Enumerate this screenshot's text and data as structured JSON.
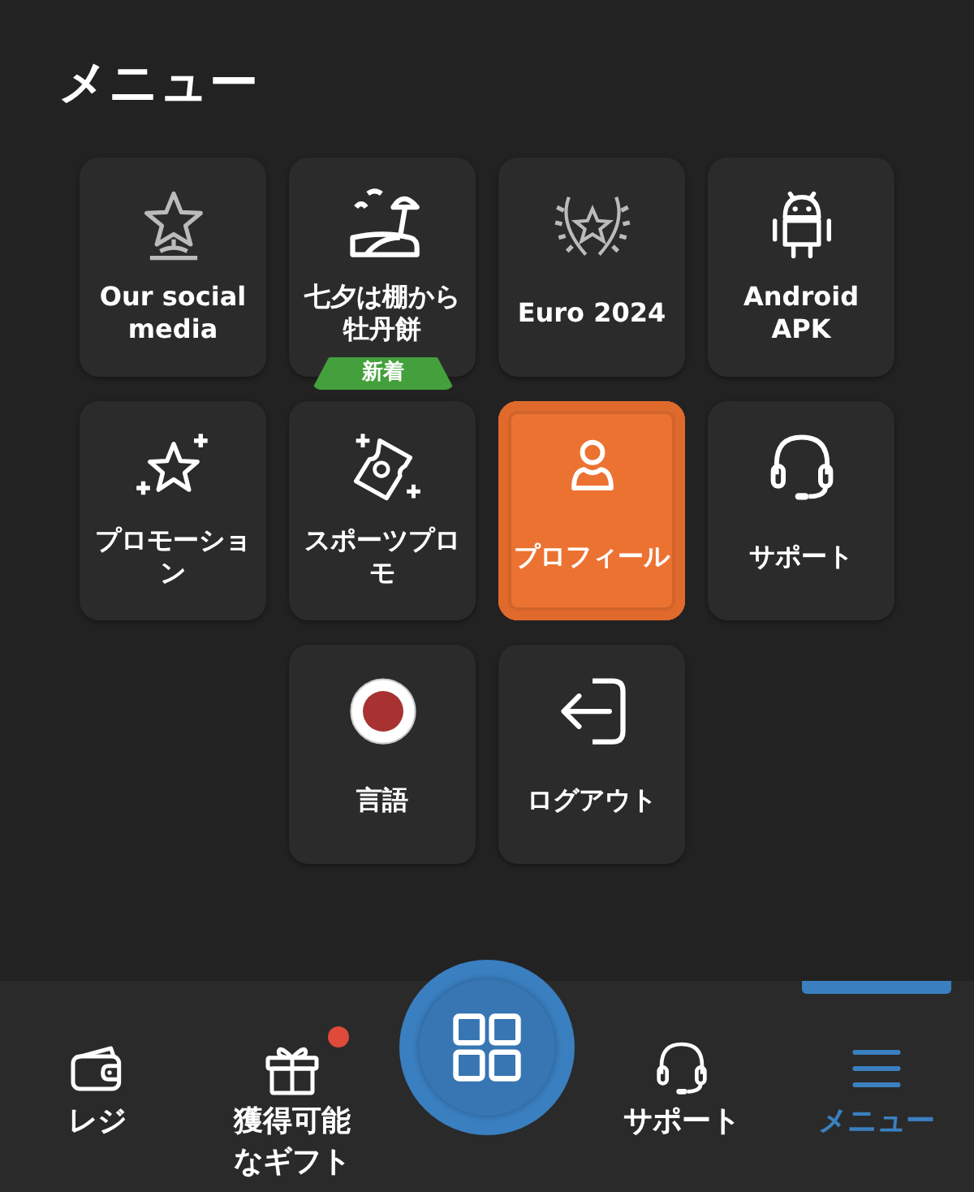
{
  "title": "メニュー",
  "grid": [
    [
      {
        "label": "Our social media",
        "selected": false
      },
      {
        "label": "七夕は棚から牡丹餅",
        "selected": false,
        "badge": "新着"
      },
      {
        "label": "Euro 2024",
        "selected": false
      },
      {
        "label": "Android APK",
        "selected": false
      }
    ],
    [
      {
        "label": "プロモーション",
        "selected": false
      },
      {
        "label": "スポーツプロモ",
        "selected": false
      },
      {
        "label": "プロフィール",
        "selected": true
      },
      {
        "label": "サポート",
        "selected": false
      }
    ],
    [
      {
        "label": "言語",
        "selected": false
      },
      {
        "label": "ログアウト",
        "selected": false
      }
    ]
  ],
  "nav": [
    {
      "kind": "tab",
      "label": "レジ",
      "selected": false,
      "dot": false
    },
    {
      "kind": "tab",
      "label": "獲得可能なギフト",
      "selected": false,
      "dot": true
    },
    {
      "kind": "fab"
    },
    {
      "kind": "tab",
      "label": "サポート",
      "selected": false,
      "dot": false
    },
    {
      "kind": "tab",
      "label": "メニュー",
      "selected": true,
      "dot": false
    }
  ]
}
